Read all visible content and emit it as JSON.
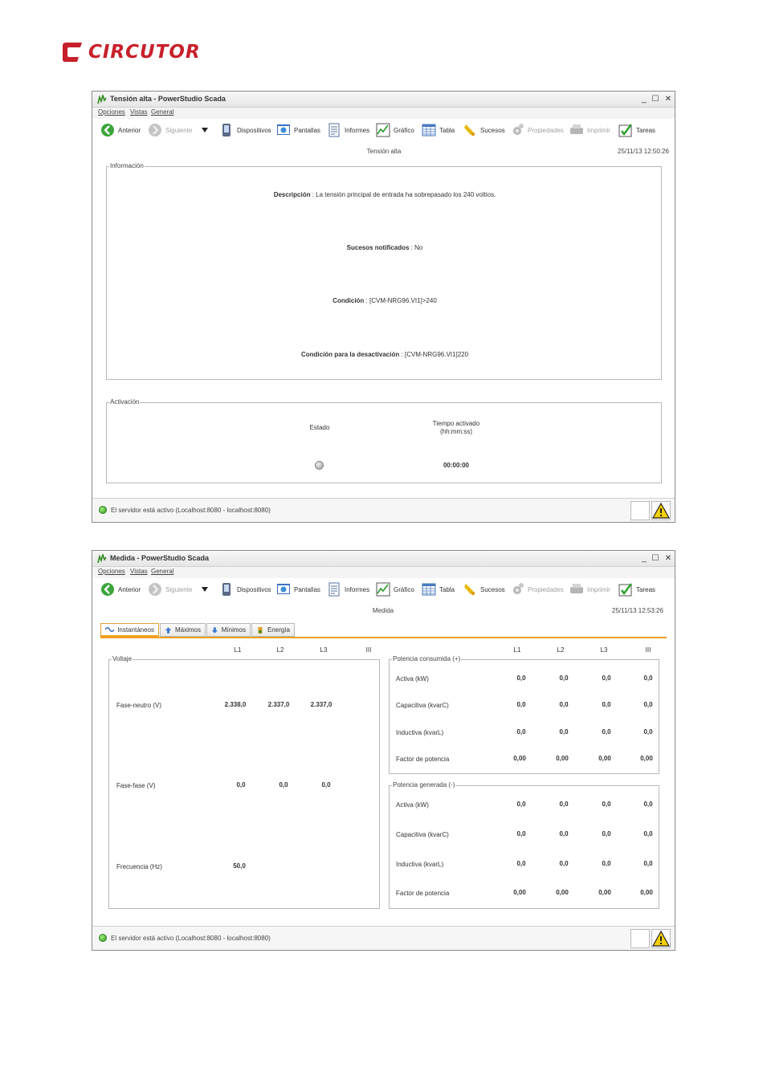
{
  "brand": {
    "name": "CIRCUTOR",
    "color": "#c8202a"
  },
  "window1": {
    "title": "Tensión alta - PowerStudio Scada",
    "controls": {
      "minimize": "_",
      "maximize": "☐",
      "close": "✕"
    },
    "menu": [
      "Opciones",
      "Vistas",
      "General"
    ],
    "toolbar": [
      {
        "label": "Anterior",
        "icon": "back-arrow-icon",
        "enabled": true
      },
      {
        "label": "Siguiente",
        "icon": "forward-arrow-icon",
        "enabled": false
      },
      {
        "label": "Dispositivos",
        "icon": "device-icon",
        "enabled": true
      },
      {
        "label": "Pantallas",
        "icon": "screens-icon",
        "enabled": true
      },
      {
        "label": "Informes",
        "icon": "report-icon",
        "enabled": true
      },
      {
        "label": "Gráfico",
        "icon": "graph-icon",
        "enabled": true
      },
      {
        "label": "Tabla",
        "icon": "table-icon",
        "enabled": true
      },
      {
        "label": "Sucesos",
        "icon": "bell-icon",
        "enabled": true
      },
      {
        "label": "Propiedades",
        "icon": "gear-icon",
        "enabled": false
      },
      {
        "label": "Imprimir",
        "icon": "printer-icon",
        "enabled": false
      },
      {
        "label": "Tareas",
        "icon": "tasks-icon",
        "enabled": true
      }
    ],
    "page_title": "Tensión alta",
    "datetime": "25/11/13 12:50:26",
    "info_group": {
      "label": "Información",
      "descripcion_label": "Descripción",
      "descripcion_value": " : La tensión principal de entrada ha sobrepasado los 240 voltios.",
      "sucesos_label": "Sucesos notificados",
      "sucesos_value": " : No",
      "condicion_label": "Condición",
      "condicion_value": " : [CVM-NRG96.VI1]>240",
      "desact_label": "Condición para la desactivación",
      "desact_value": " : [CVM-NRG96.VI1]220"
    },
    "activation_group": {
      "label": "Activación",
      "estado_label": "Estado",
      "tiempo_label_1": "Tiempo activado",
      "tiempo_label_2": "(hh:mm:ss)",
      "tiempo_value": "00:00:00"
    },
    "status": "El servidor está activo (Localhost:8080 - localhost:8080)"
  },
  "window2": {
    "title": "Medida - PowerStudio Scada",
    "controls": {
      "minimize": "_",
      "maximize": "☐",
      "close": "✕"
    },
    "menu": [
      "Opciones",
      "Vistas",
      "General"
    ],
    "toolbar": [
      {
        "label": "Anterior",
        "icon": "back-arrow-icon",
        "enabled": true
      },
      {
        "label": "Siguiente",
        "icon": "forward-arrow-icon",
        "enabled": false
      },
      {
        "label": "Dispositivos",
        "icon": "device-icon",
        "enabled": true
      },
      {
        "label": "Pantallas",
        "icon": "screens-icon",
        "enabled": true
      },
      {
        "label": "Informes",
        "icon": "report-icon",
        "enabled": true
      },
      {
        "label": "Gráfico",
        "icon": "graph-icon",
        "enabled": true
      },
      {
        "label": "Tabla",
        "icon": "table-icon",
        "enabled": true
      },
      {
        "label": "Sucesos",
        "icon": "bell-icon",
        "enabled": true
      },
      {
        "label": "Propiedades",
        "icon": "gear-icon",
        "enabled": false
      },
      {
        "label": "Imprimir",
        "icon": "printer-icon",
        "enabled": false
      },
      {
        "label": "Tareas",
        "icon": "tasks-icon",
        "enabled": true
      }
    ],
    "page_title": "Medida",
    "datetime": "25/11/13 12:53:26",
    "tabs": [
      "Instantáneos",
      "Máximos",
      "Mínimos",
      "Energía"
    ],
    "left_columns": [
      "L1",
      "L2",
      "L3",
      "III"
    ],
    "right_columns": [
      "L1",
      "L2",
      "L3",
      "III"
    ],
    "voltaje": {
      "label": "Voltaje",
      "rows": [
        {
          "name": "Fase-neutro (V)",
          "values": [
            "2.338,0",
            "2.337,0",
            "2.337,0"
          ]
        },
        {
          "name": "Fase-fase (V)",
          "values": [
            "0,0",
            "0,0",
            "0,0"
          ]
        },
        {
          "name": "Frecuencia (Hz)",
          "values": [
            "50,0"
          ]
        }
      ]
    },
    "potencia_consumida": {
      "label": "Potencia consumida (+)",
      "rows": [
        {
          "name": "Activa (kW)",
          "values": [
            "0,0",
            "0,0",
            "0,0",
            "0,0"
          ]
        },
        {
          "name": "Capacitiva (kvarC)",
          "values": [
            "0,0",
            "0,0",
            "0,0",
            "0,0"
          ]
        },
        {
          "name": "Inductiva (kvarL)",
          "values": [
            "0,0",
            "0,0",
            "0,0",
            "0,0"
          ]
        },
        {
          "name": "Factor de potencia",
          "values": [
            "0,00",
            "0,00",
            "0,00",
            "0,00"
          ]
        }
      ]
    },
    "potencia_generada": {
      "label": "Potencia generada (-)",
      "rows": [
        {
          "name": "Activa (kW)",
          "values": [
            "0,0",
            "0,0",
            "0,0",
            "0,0"
          ]
        },
        {
          "name": "Capacitiva (kvarC)",
          "values": [
            "0,0",
            "0,0",
            "0,0",
            "0,0"
          ]
        },
        {
          "name": "Inductiva (kvarL)",
          "values": [
            "0,0",
            "0,0",
            "0,0",
            "0,0"
          ]
        },
        {
          "name": "Factor de potencia",
          "values": [
            "0,00",
            "0,00",
            "0,00",
            "0,00"
          ]
        }
      ]
    },
    "status": "El servidor está activo (Localhost:8080 - localhost:8080)"
  }
}
